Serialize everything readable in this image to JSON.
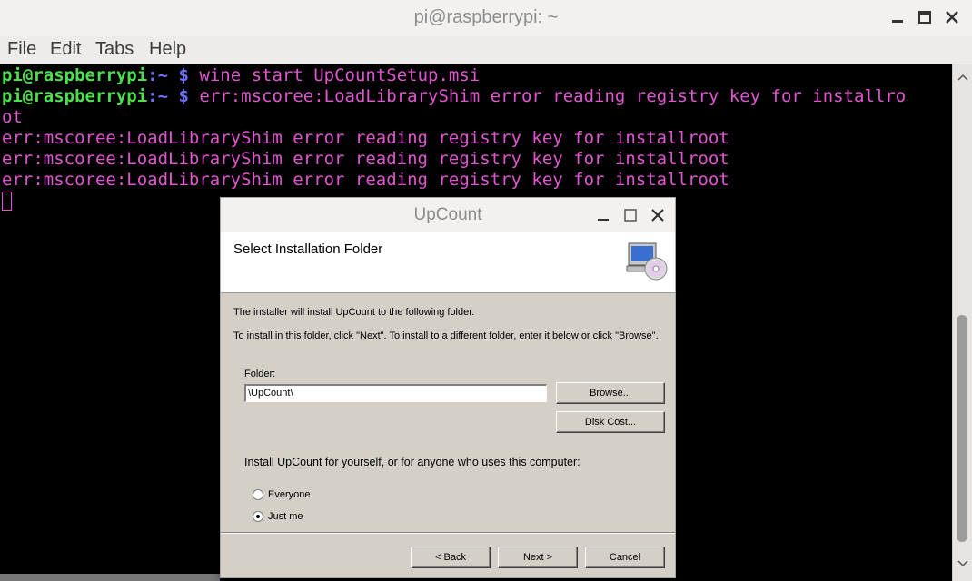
{
  "terminal_window": {
    "title": "pi@raspberrypi: ~",
    "menu": [
      "File",
      "Edit",
      "Tabs",
      "Help"
    ],
    "lines": [
      {
        "user": "pi@raspberrypi",
        "path": ":~",
        "prompt": " $",
        "text": " wine start UpCountSetup.msi"
      },
      {
        "user": "pi@raspberrypi",
        "path": ":~",
        "prompt": " $",
        "text": " err:mscoree:LoadLibraryShim error reading registry key for installro"
      },
      {
        "text": "ot"
      },
      {
        "text": "err:mscoree:LoadLibraryShim error reading registry key for installroot"
      },
      {
        "text": "err:mscoree:LoadLibraryShim error reading registry key for installroot"
      },
      {
        "text": "err:mscoree:LoadLibraryShim error reading registry key for installroot"
      }
    ]
  },
  "dialog": {
    "title": "UpCount",
    "heading": "Select Installation Folder",
    "info1": "The installer will install UpCount to the following folder.",
    "info2": "To install in this folder, click \"Next\". To install to a different folder, enter it below or click \"Browse\".",
    "folder_label": "Folder:",
    "folder_value": "\\UpCount\\",
    "browse": "Browse...",
    "disk_cost": "Disk Cost...",
    "scope_question": "Install UpCount for yourself, or for anyone who uses this computer:",
    "options": [
      {
        "label": "Everyone",
        "selected": false
      },
      {
        "label": "Just me",
        "selected": true
      }
    ],
    "back": "< Back",
    "next": "Next >",
    "cancel": "Cancel"
  },
  "icons": [
    "minimize-icon",
    "maximize-icon",
    "close-icon",
    "computer-cd-icon",
    "scroll-up-icon",
    "scroll-down-icon"
  ],
  "colors": {
    "prompt_user": "#4de04d",
    "prompt_symbol": "#7070ff",
    "terminal_text": "#e055d0",
    "terminal_bg": "#000000",
    "dialog_bg": "#d4d0c8"
  }
}
